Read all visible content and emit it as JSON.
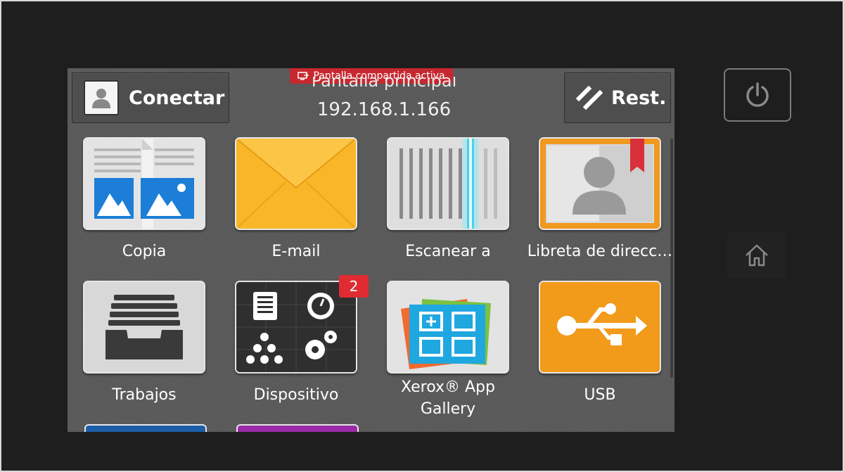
{
  "header": {
    "connect_label": "Conectar",
    "reset_label": "Rest.",
    "screen_title": "Pantalla principal",
    "ip_address": "192.168.1.166",
    "share_banner": "Pantalla compartida activa"
  },
  "apps": [
    {
      "label": "Copia",
      "icon": "copy-icon"
    },
    {
      "label": "E-mail",
      "icon": "envelope-icon"
    },
    {
      "label": "Escanear a",
      "icon": "scanner-icon"
    },
    {
      "label": "Libreta de direcc…",
      "icon": "address-book-icon"
    },
    {
      "label": "Trabajos",
      "icon": "jobs-tray-icon"
    },
    {
      "label": "Dispositivo",
      "icon": "device-icon",
      "badge": "2"
    },
    {
      "label": "Xerox® App Gallery",
      "icon": "app-gallery-icon"
    },
    {
      "label": "USB",
      "icon": "usb-icon"
    }
  ],
  "colors": {
    "email": "#f7b324",
    "address_book": "#f0991f",
    "usb": "#f29a1a",
    "badge": "#e02b32",
    "banner": "#c7282f"
  }
}
